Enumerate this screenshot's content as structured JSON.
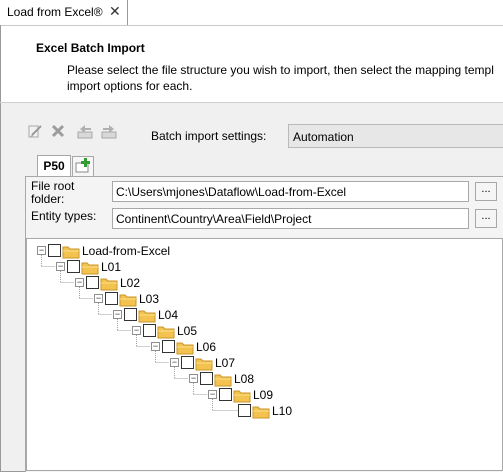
{
  "doc_tab": {
    "title": "Load from Excel®",
    "close": "✕"
  },
  "header": {
    "title": "Excel Batch Import",
    "description_line1": "Please select the file structure you wish to import, then select the mapping templ",
    "description_line2": "import options for each."
  },
  "toolbar": {
    "icons": [
      "edit-icon",
      "delete-icon",
      "move-left-icon",
      "move-right-icon"
    ],
    "settings_label": "Batch import settings:",
    "settings_value": "Automation"
  },
  "tabs": {
    "active": "P50"
  },
  "fields": {
    "root_label_line1": "File root",
    "root_label_line2": "folder:",
    "root_value": "C:\\Users\\mjones\\Dataflow\\Load-from-Excel",
    "root_browse": "...",
    "entity_label": "Entity types:",
    "entity_value": "Continent\\Country\\Area\\Field\\Project",
    "entity_browse": "..."
  },
  "tree": {
    "nodes": [
      "Load-from-Excel",
      "L01",
      "L02",
      "L03",
      "L04",
      "L05",
      "L06",
      "L07",
      "L08",
      "L09",
      "L10"
    ]
  },
  "colors": {
    "folder": "#f3c24f",
    "body_bg": "#f0f0f0",
    "add_tab_plus": "#2f9e2f"
  }
}
